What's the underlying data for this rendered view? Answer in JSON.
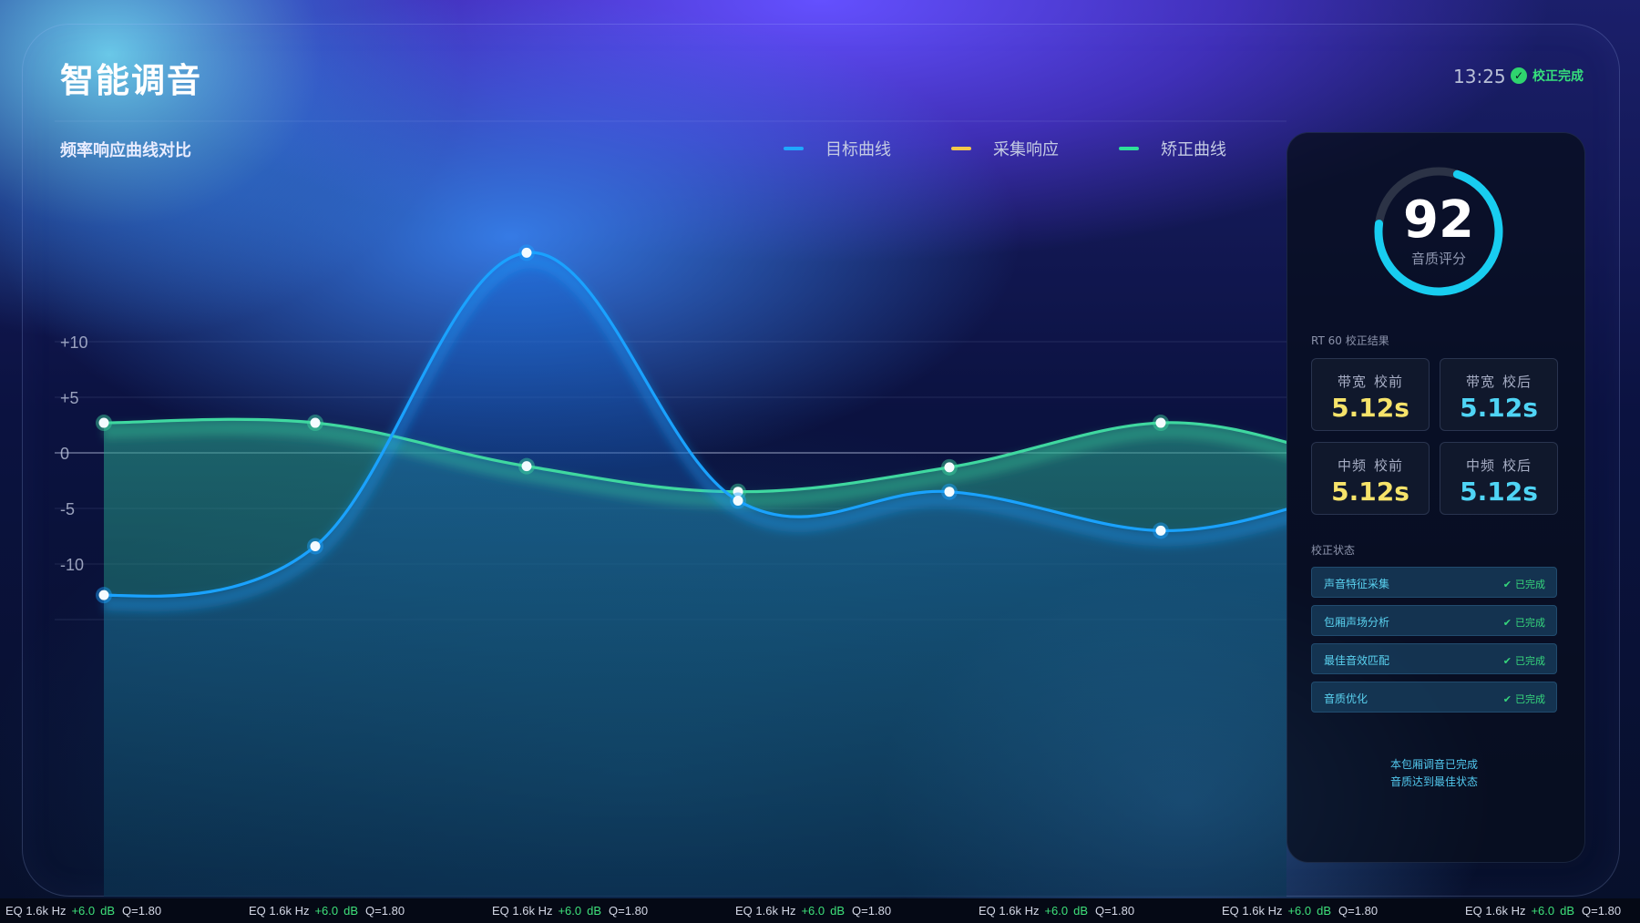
{
  "app": {
    "title": "智能调音",
    "time": "13:25",
    "status": "校正完成"
  },
  "chart_data": {
    "type": "line",
    "title": "频率响应曲线对比",
    "yticks": [
      "+10",
      "+5",
      "0",
      "-5",
      "-10"
    ],
    "ylim": [
      -15,
      15
    ],
    "legend_placement": "top-right",
    "legend": [
      {
        "name": "目标曲线",
        "color": "#1fa8ff"
      },
      {
        "name": "采集响应",
        "color": "#f5c84a"
      },
      {
        "name": "矫正曲线",
        "color": "#2ee09a"
      }
    ],
    "x": [
      0,
      1,
      2,
      3,
      4,
      5
    ],
    "series": [
      {
        "name": "矫正曲线",
        "color": "#3fd8a0",
        "points": [
          2.7,
          2.7,
          -1.2,
          -3.5,
          -1.3,
          2.7
        ]
      },
      {
        "name": "目标曲线",
        "color": "#1aa2ff",
        "points": [
          -12.8,
          -8.4,
          18,
          -4.3,
          -3.5,
          -7.0
        ]
      }
    ]
  },
  "score": {
    "value": "92",
    "label": "音质评分",
    "fraction": 0.72
  },
  "rt60": {
    "title": "RT 60 校正结果",
    "cards": [
      {
        "band": "带宽",
        "stage": "校前",
        "value": "5.12s",
        "kind": "before"
      },
      {
        "band": "带宽",
        "stage": "校后",
        "value": "5.12s",
        "kind": "after"
      },
      {
        "band": "中频",
        "stage": "校前",
        "value": "5.12s",
        "kind": "before"
      },
      {
        "band": "中频",
        "stage": "校后",
        "value": "5.12s",
        "kind": "after"
      }
    ]
  },
  "calibration": {
    "title": "校正状态",
    "steps": [
      {
        "label": "声音特征采集",
        "status": "已完成"
      },
      {
        "label": "包厢声场分析",
        "status": "已完成"
      },
      {
        "label": "最佳音效匹配",
        "status": "已完成"
      },
      {
        "label": "音质优化",
        "status": "已完成"
      }
    ],
    "message_line1": "本包厢调音已完成",
    "message_line2": "音质达到最佳状态"
  },
  "ticker": [
    {
      "eq": "EQ 1.6k Hz",
      "gain": "+6.0",
      "unit": "dB",
      "q": "Q=1.80"
    },
    {
      "eq": "EQ 1.6k Hz",
      "gain": "+6.0",
      "unit": "dB",
      "q": "Q=1.80"
    },
    {
      "eq": "EQ 1.6k Hz",
      "gain": "+6.0",
      "unit": "dB",
      "q": "Q=1.80"
    },
    {
      "eq": "EQ 1.6k Hz",
      "gain": "+6.0",
      "unit": "dB",
      "q": "Q=1.80"
    },
    {
      "eq": "EQ 1.6k Hz",
      "gain": "+6.0",
      "unit": "dB",
      "q": "Q=1.80"
    },
    {
      "eq": "EQ 1.6k Hz",
      "gain": "+6.0",
      "unit": "dB",
      "q": "Q=1.80"
    },
    {
      "eq": "EQ 1.6k Hz",
      "gain": "+6.0",
      "unit": "dB",
      "q": "Q=1.80"
    }
  ],
  "icons": {
    "status_ok": "check-circle-icon",
    "step_done": "check-icon"
  }
}
